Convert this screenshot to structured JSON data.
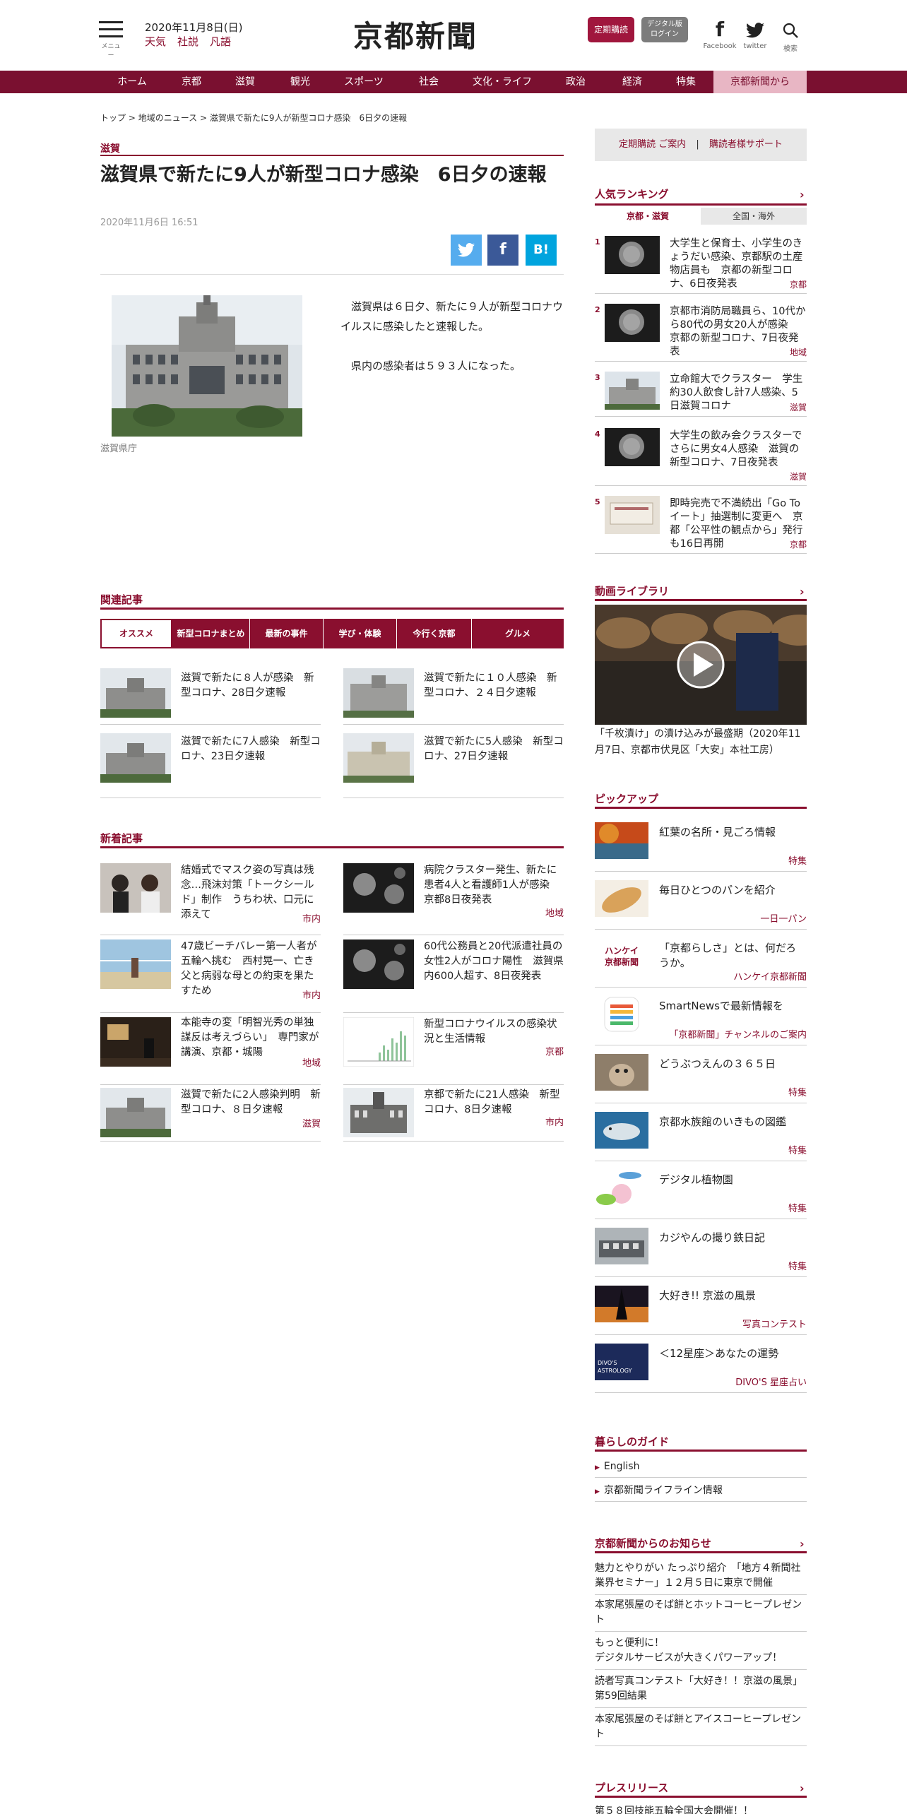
{
  "header": {
    "menu_label": "メニュー",
    "date": "2020年11月8日(日)",
    "links": [
      "天気",
      "社説",
      "凡語"
    ],
    "logo": "京都新聞",
    "subscribe": "定期購読",
    "digital_line1": "デジタル版",
    "digital_line2": "ログイン",
    "facebook_label": "Facebook",
    "twitter_label": "twitter",
    "search_label": "検索"
  },
  "nav": {
    "items": [
      "ホーム",
      "京都",
      "滋賀",
      "観光",
      "スポーツ",
      "社会",
      "文化・ライフ",
      "政治",
      "経済",
      "特集",
      "京都新聞から"
    ],
    "active": "京都新聞から"
  },
  "breadcrumb": {
    "items": [
      "トップ",
      "地域のニュース",
      "滋賀県で新たに9人が新型コロナ感染　6日夕の速報"
    ],
    "separator": ">"
  },
  "article": {
    "category": "滋賀",
    "title": "滋賀県で新たに9人が新型コロナ感染　6日夕の速報",
    "date": "2020年11月6日 16:51",
    "share": {
      "twitter": "t",
      "facebook": "f",
      "hatena": "B!"
    },
    "photo_caption": "滋賀県庁",
    "paragraphs": [
      "滋賀県は６日夕、新たに９人が新型コロナウイルスに感染したと速報した。",
      "県内の感染者は５９３人になった。"
    ]
  },
  "related": {
    "heading": "関連記事",
    "tabs": [
      "オススメ",
      "新型コロナまとめ",
      "最新の事件",
      "学び・体験",
      "今行く京都",
      "グルメ"
    ],
    "active_tab": "オススメ",
    "items": [
      {
        "title": "滋賀で新たに８人が感染　新型コロナ、28日夕速報"
      },
      {
        "title": "滋賀で新たに１０人感染　新型コロナ、２４日夕速報"
      },
      {
        "title": "滋賀で新たに7人感染　新型コロナ、23日夕速報"
      },
      {
        "title": "滋賀で新たに5人感染　新型コロナ、27日夕速報"
      }
    ]
  },
  "latest": {
    "heading": "新着記事",
    "items": [
      {
        "title": "結婚式でマスク姿の写真は残念…飛沫対策「トークシールド」制作　うちわ状、口元に添えて",
        "tag": "市内"
      },
      {
        "title": "病院クラスター発生、新たに患者4人と看護師1人が感染　京都8日夜発表",
        "tag": "地域"
      },
      {
        "title": "47歳ビーチバレー第一人者が五輪へ挑む　西村晃一、亡き父と病弱な母との約束を果たすため",
        "tag": "市内"
      },
      {
        "title": "60代公務員と20代派遣社員の女性2人がコロナ陽性　滋賀県内600人超す、8日夜発表",
        "tag": ""
      },
      {
        "title": "本能寺の変「明智光秀の単独謀反は考えづらい」　専門家が講演、京都・城陽",
        "tag": "地域"
      },
      {
        "title": "新型コロナウイルスの感染状況と生活情報",
        "tag": "京都"
      },
      {
        "title": "滋賀で新たに2人感染判明　新型コロナ、８日夕速報",
        "tag": "滋賀"
      },
      {
        "title": "京都で新たに21人感染　新型コロナ、8日夕速報",
        "tag": "市内"
      }
    ]
  },
  "sidebar": {
    "box_links": [
      "定期購読 ご案内",
      "|",
      "購読者様サポート"
    ],
    "ranking": {
      "heading": "人気ランキング",
      "tabs": [
        "京都・滋賀",
        "全国・海外"
      ],
      "active_tab": "京都・滋賀",
      "items": [
        {
          "num": "1",
          "title": "大学生と保育士、小学生のきょうだい感染、京都駅の土産物店員も　京都の新型コロナ、6日夜発表",
          "tag": "京都"
        },
        {
          "num": "2",
          "title": "京都市消防局職員ら、10代から80代の男女20人が感染　京都の新型コロナ、7日夜発表",
          "tag": "地域"
        },
        {
          "num": "3",
          "title": "立命館大でクラスター　学生約30人飲食し計7人感染、5日滋賀コロナ",
          "tag": "滋賀"
        },
        {
          "num": "4",
          "title": "大学生の飲み会クラスターでさらに男女4人感染　滋賀の新型コロナ、7日夜発表",
          "tag": "滋賀"
        },
        {
          "num": "5",
          "title": "即時完売で不満続出「Go To イート」抽選制に変更へ　京都「公平性の観点から」発行も16日再開",
          "tag": "京都"
        }
      ]
    },
    "video": {
      "heading": "動画ライブラリ",
      "caption": "「千枚漬け」の漬け込みが最盛期（2020年11月7日、京都市伏見区「大安」本社工房）"
    },
    "pickup": {
      "heading": "ピックアップ",
      "items": [
        {
          "title": "紅葉の名所・見ごろ情報",
          "tag": "特集"
        },
        {
          "title": "毎日ひとつのパンを紹介",
          "tag": "一日一パン"
        },
        {
          "title": "「京都らしさ」とは、何だろうか。",
          "tag": "ハンケイ京都新聞"
        },
        {
          "title": "SmartNewsで最新情報を",
          "tag": "「京都新聞」チャンネルのご案内"
        },
        {
          "title": "どうぶつえんの３６５日",
          "tag": "特集"
        },
        {
          "title": "京都水族館のいきもの図鑑",
          "tag": "特集"
        },
        {
          "title": "デジタル植物園",
          "tag": "特集"
        },
        {
          "title": "カジやんの撮り鉄日記",
          "tag": "特集"
        },
        {
          "title": "大好き!! 京滋の風景",
          "tag": "写真コンテスト"
        },
        {
          "title": "＜12星座＞あなたの運勢",
          "tag": "DIVO'S 星座占い"
        }
      ],
      "hankei_logo_line1": "ハンケイ",
      "hankei_logo_line2": "京都新聞",
      "divos_logo_line1": "DIVO'S",
      "divos_logo_line2": "ASTROLOGY"
    },
    "guide": {
      "heading": "暮らしのガイド",
      "items": [
        "English",
        "京都新聞ライフライン情報"
      ]
    },
    "notices": {
      "heading": "京都新聞からのお知らせ",
      "items": [
        "魅力とやりがい たっぷり紹介　「地方４新聞社業界セミナー」１２月５日に東京で開催",
        "本家尾張屋のそば餅とホットコーヒープレゼント",
        "もっと便利に！\nデジタルサービスが大きくパワーアップ！",
        "読者写真コンテスト「大好き！！京滋の風景」第59回結果",
        "本家尾張屋のそば餅とアイスコーヒープレゼント"
      ]
    },
    "press": {
      "heading": "プレスリリース",
      "first_item": "第５８回技能五輪全国大会開催！！"
    }
  },
  "colors": {
    "brand": "#8a0f2f",
    "nav_bg": "#7a1030",
    "nav_active_bg": "#e8b6c4",
    "twitter": "#55acee",
    "facebook": "#3b5998",
    "hatena": "#00a4de"
  }
}
